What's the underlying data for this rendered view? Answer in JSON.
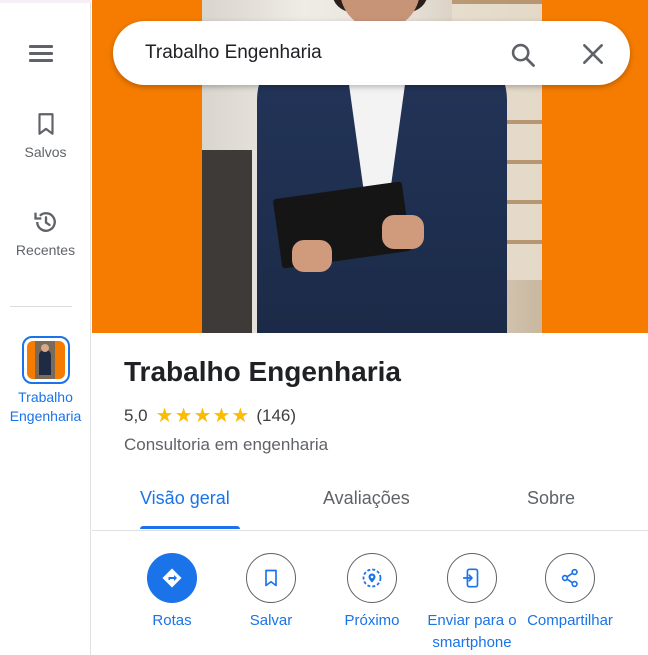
{
  "rail": {
    "menu_icon": "hamburger-menu-icon",
    "items": [
      {
        "label": "Salvos",
        "icon": "bookmark-icon"
      },
      {
        "label": "Recentes",
        "icon": "history-icon"
      }
    ],
    "place": {
      "label": "Trabalho Engenharia",
      "icon": "place-thumbnail"
    }
  },
  "search": {
    "value": "Trabalho Engenharia",
    "search_icon": "search-icon",
    "clear_icon": "close-icon"
  },
  "place": {
    "title": "Trabalho Engenharia",
    "rating": "5,0",
    "stars": 5,
    "review_count": "(146)",
    "category": "Consultoria em engenharia"
  },
  "tabs": [
    {
      "label": "Visão geral",
      "active": true
    },
    {
      "label": "Avaliações",
      "active": false
    },
    {
      "label": "Sobre",
      "active": false
    }
  ],
  "actions": [
    {
      "label": "Rotas",
      "icon": "directions-icon"
    },
    {
      "label": "Salvar",
      "icon": "bookmark-icon"
    },
    {
      "label": "Próximo",
      "icon": "nearby-icon"
    },
    {
      "label": "Enviar para o smartphone",
      "icon": "send-to-phone-icon"
    },
    {
      "label": "Compartilhar",
      "icon": "share-icon"
    }
  ],
  "colors": {
    "accent": "#1a73e8",
    "star": "#fbbc04",
    "hero_orange": "#f57c00"
  }
}
